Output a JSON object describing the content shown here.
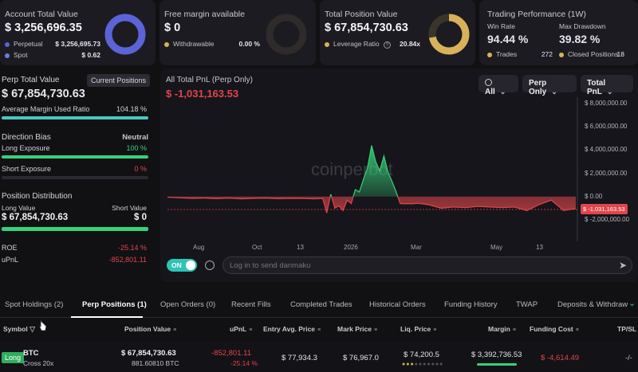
{
  "cards": {
    "account": {
      "label": "Account Total Value",
      "value": "$ 3,256,696.35",
      "rows": [
        {
          "label": "Perpetual",
          "value": "$ 3,256,695.73",
          "color": "#5b63d6"
        },
        {
          "label": "Spot",
          "value": "$ 0.62",
          "color": "#6a7ee0"
        }
      ]
    },
    "margin": {
      "label": "Free margin available",
      "value": "$ 0",
      "rows": [
        {
          "label": "Withdrawable",
          "value": "0.00 %",
          "color": "#d8b25a"
        }
      ]
    },
    "position": {
      "label": "Total Position Value",
      "value": "$ 67,854,730.63",
      "rows": [
        {
          "label": "Leverage Ratio",
          "value": "20.84x",
          "color": "#d8b25a"
        }
      ]
    },
    "performance": {
      "label": "Trading Performance (1W)",
      "win_rate_label": "Win Rate",
      "win_rate": "94.44 %",
      "drawdown_label": "Max Drawdown",
      "drawdown": "39.82 %",
      "trades_label": "Trades",
      "trades": "272",
      "closed_label": "Closed Positions",
      "closed": "18"
    }
  },
  "perp": {
    "title": "Perp Total Value",
    "current_positions_btn": "Current Positions",
    "value": "$ 67,854,730.63",
    "avg_margin_label": "Average Margin Used Ratio",
    "avg_margin_value": "104.18 %",
    "avg_margin_fraction": 1.0,
    "direction_label": "Direction Bias",
    "direction_value": "Neutral",
    "long_label": "Long Exposure",
    "long_value": "100 %",
    "long_fraction": 1.0,
    "short_label": "Short Exposure",
    "short_value": "0 %",
    "short_fraction": 0.0,
    "distribution_label": "Position Distribution",
    "long_value_label": "Long Value",
    "short_value_label": "Short Value",
    "long_amount": "$ 67,854,730.63",
    "short_amount": "$ 0",
    "roe_label": "ROE",
    "roe_value": "-25.14 %",
    "upnl_label": "uPnL",
    "upnl_value": "-852,801.11"
  },
  "chart_panel": {
    "title": "All Total PnL (Perp Only)",
    "current_value": "$ -1,031,163.53",
    "filter_all": "All",
    "filter_perp": "Perp Only",
    "filter_metric": "Total PnL",
    "watermark": "coinperbot",
    "toggle_label": "ON",
    "danmaku_placeholder": "Log in to send danmaku"
  },
  "chart_data": {
    "type": "area",
    "title": "All Total PnL (Perp Only)",
    "y_ticks": [
      "$ 8,000,000.00",
      "$ 6,000,000.00",
      "$ 4,000,000.00",
      "$ 2,000,000.00",
      "$ 0.00",
      "$ -2,000,000.00"
    ],
    "ylim": [
      -2500000,
      8500000
    ],
    "x_ticks": [
      "Aug",
      "Oct",
      "13",
      "2026",
      "Mar",
      "May",
      "13"
    ],
    "current_label": "$ -1,031,163.53",
    "x": [
      0,
      3,
      6,
      9,
      12,
      15,
      18,
      21,
      24,
      27,
      30,
      33,
      36,
      38,
      39,
      40,
      41,
      42,
      43,
      44,
      45,
      46,
      47,
      48,
      49,
      50,
      51,
      52,
      53,
      54,
      55,
      56,
      57,
      58,
      59,
      60,
      61,
      62,
      64,
      67,
      70,
      73,
      76,
      79,
      82,
      85,
      88,
      91,
      94,
      97,
      100
    ],
    "y": [
      -50000,
      -100000,
      -150000,
      -120000,
      -180000,
      -130000,
      -200000,
      -150000,
      -120000,
      -180000,
      -150000,
      -160000,
      -200000,
      -150000,
      -1400000,
      200000,
      -1000000,
      -800000,
      -1200000,
      -300000,
      -600000,
      600000,
      400000,
      1500000,
      2500000,
      4400000,
      3000000,
      2200000,
      3500000,
      2100000,
      1300000,
      400000,
      -600000,
      -620000,
      -600000,
      -620000,
      -580000,
      -600000,
      -700000,
      -1000000,
      -900000,
      -950000,
      -850000,
      -900000,
      -950000,
      -900000,
      -1200000,
      -700000,
      -300000,
      -1200000,
      -1031163
    ]
  },
  "tabs": [
    {
      "label": "Spot Holdings (2)",
      "active": false
    },
    {
      "label": "Perp Positions (1)",
      "active": true
    },
    {
      "label": "Open Orders (0)",
      "active": false
    },
    {
      "label": "Recent Fills",
      "active": false
    },
    {
      "label": "Completed Trades",
      "active": false
    },
    {
      "label": "Historical Orders",
      "active": false
    },
    {
      "label": "Funding History",
      "active": false
    },
    {
      "label": "TWAP",
      "active": false
    },
    {
      "label": "Deposits & Withdraw",
      "active": false
    }
  ],
  "table": {
    "headers": {
      "symbol": "Symbol",
      "position_value": "Position Value",
      "upnl": "uPnL",
      "entry": "Entry Avg. Price",
      "mark": "Mark Price",
      "liq": "Liq. Price",
      "margin": "Margin",
      "funding": "Funding Cost",
      "tpsl": "TP/SL"
    },
    "row": {
      "side": "Long",
      "symbol": "BTC",
      "mode": "Cross 20x",
      "position_value": "$ 67,854,730.63",
      "position_size": "881.60810 BTC",
      "upnl": "-852,801.11",
      "upnl_pct": "-25.14 %",
      "entry": "$ 77,934.3",
      "mark": "$ 76,967.0",
      "liq": "$ 74,200.5",
      "margin": "$ 3,392,736.53",
      "funding": "$ -4,614.49",
      "tpsl": "-/-"
    }
  },
  "colors": {
    "accent_teal": "#2ec4b6",
    "green": "#37d27a",
    "red": "#e0454d",
    "blue": "#5b63d6",
    "gold": "#d8b25a"
  }
}
